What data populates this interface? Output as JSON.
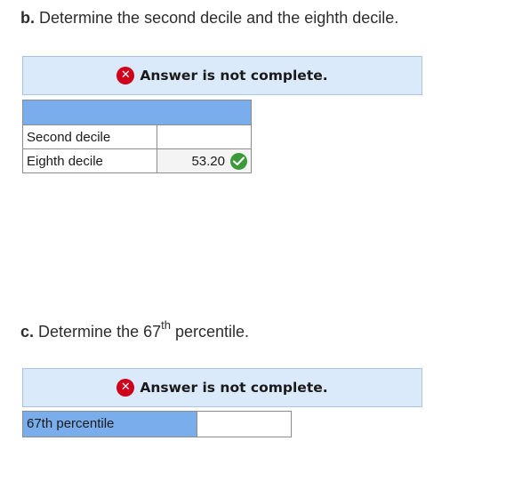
{
  "part_b": {
    "label": "b.",
    "text": "Determine the second decile and the eighth decile."
  },
  "banner_b": {
    "icon": "x-circle-icon",
    "text": "Answer is not complete."
  },
  "deciles_table": {
    "rows": [
      {
        "label": "Second decile",
        "value": ""
      },
      {
        "label": "Eighth decile",
        "value": "53.20",
        "status": "correct"
      }
    ]
  },
  "part_c": {
    "label": "c.",
    "text_before": "Determine the 67",
    "superscript": "th",
    "text_after": " percentile."
  },
  "banner_c": {
    "icon": "x-circle-icon",
    "text": "Answer is not complete."
  },
  "percentile_row": {
    "label": "67th percentile",
    "value": ""
  },
  "colors": {
    "banner_bg": "#dbeafa",
    "header_blue": "#7aadec",
    "error_red": "#d0021b",
    "correct_green": "#3a9a3a"
  }
}
